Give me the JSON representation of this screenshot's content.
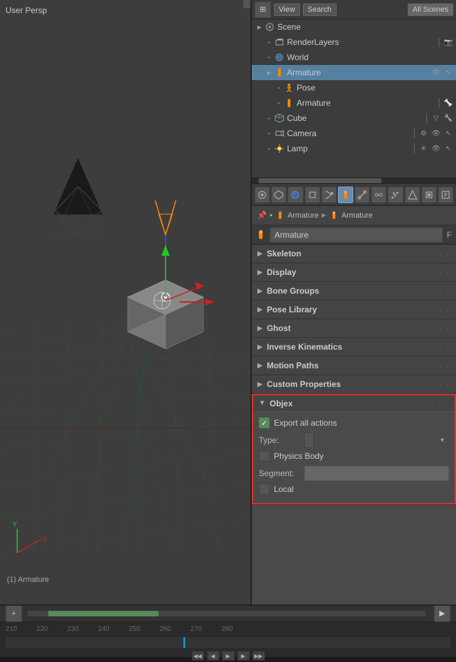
{
  "viewport": {
    "label": "User Persp",
    "bottom_label": "(1) Armature"
  },
  "timeline": {
    "frame_numbers": [
      "210",
      "220",
      "230",
      "240",
      "250",
      "260",
      "270",
      "280"
    ]
  },
  "outliner": {
    "buttons": [
      "icon-grid",
      "View",
      "Search"
    ],
    "all_scenes": "All Scenes",
    "items": [
      {
        "depth": 0,
        "label": "Scene",
        "icon": "scene",
        "expandable": true,
        "expanded": true
      },
      {
        "depth": 1,
        "label": "RenderLayers",
        "icon": "renderlayers",
        "expandable": false
      },
      {
        "depth": 1,
        "label": "World",
        "icon": "world",
        "expandable": false
      },
      {
        "depth": 1,
        "label": "Armature",
        "icon": "armature",
        "expandable": true,
        "expanded": true,
        "has_eye": true,
        "has_cursor": true
      },
      {
        "depth": 2,
        "label": "Pose",
        "icon": "pose",
        "expandable": false
      },
      {
        "depth": 2,
        "label": "Armature",
        "icon": "armature2",
        "expandable": false,
        "has_separator": true
      },
      {
        "depth": 1,
        "label": "Cube",
        "icon": "cube",
        "expandable": false,
        "has_separator": true
      },
      {
        "depth": 1,
        "label": "Camera",
        "icon": "camera",
        "expandable": false,
        "has_separator": true,
        "has_eye": true,
        "has_cursor": true
      },
      {
        "depth": 1,
        "label": "Lamp",
        "icon": "lamp",
        "expandable": false,
        "has_separator": true,
        "has_eye": true,
        "has_cursor": true
      }
    ]
  },
  "props": {
    "toolbar_icons": [
      "grid",
      "triangle",
      "sphere",
      "box",
      "chain",
      "person",
      "bone",
      "wrench",
      "particles",
      "physics",
      "constraints",
      "script"
    ],
    "breadcrumb": [
      "pin-icon",
      "dot-icon",
      "armature-icon",
      "Armature",
      "arrow",
      "pose-icon",
      "Armature"
    ],
    "name": "Armature",
    "name_letter": "F",
    "sections": [
      {
        "id": "skeleton",
        "label": "Skeleton",
        "expanded": false
      },
      {
        "id": "display",
        "label": "Display",
        "expanded": false
      },
      {
        "id": "bone-groups",
        "label": "Bone Groups",
        "expanded": false
      },
      {
        "id": "pose-library",
        "label": "Pose Library",
        "expanded": false
      },
      {
        "id": "ghost",
        "label": "Ghost",
        "expanded": false
      },
      {
        "id": "inverse-kinematics",
        "label": "Inverse Kinematics",
        "expanded": false
      },
      {
        "id": "motion-paths",
        "label": "Motion Paths",
        "expanded": false
      },
      {
        "id": "custom-properties",
        "label": "Custom Properties",
        "expanded": false
      },
      {
        "id": "objex",
        "label": "Objex",
        "expanded": true,
        "highlighted": true,
        "arrow": "▼",
        "fields": [
          {
            "type": "checkbox",
            "label": "Export all actions",
            "checked": true
          },
          {
            "type": "select",
            "label": "Type:",
            "value": ""
          },
          {
            "type": "checkbox",
            "label": "Physics Body",
            "checked": false
          },
          {
            "type": "text-input",
            "label": "Segment:",
            "value": ""
          },
          {
            "type": "checkbox",
            "label": "Local",
            "checked": false
          }
        ]
      }
    ]
  }
}
